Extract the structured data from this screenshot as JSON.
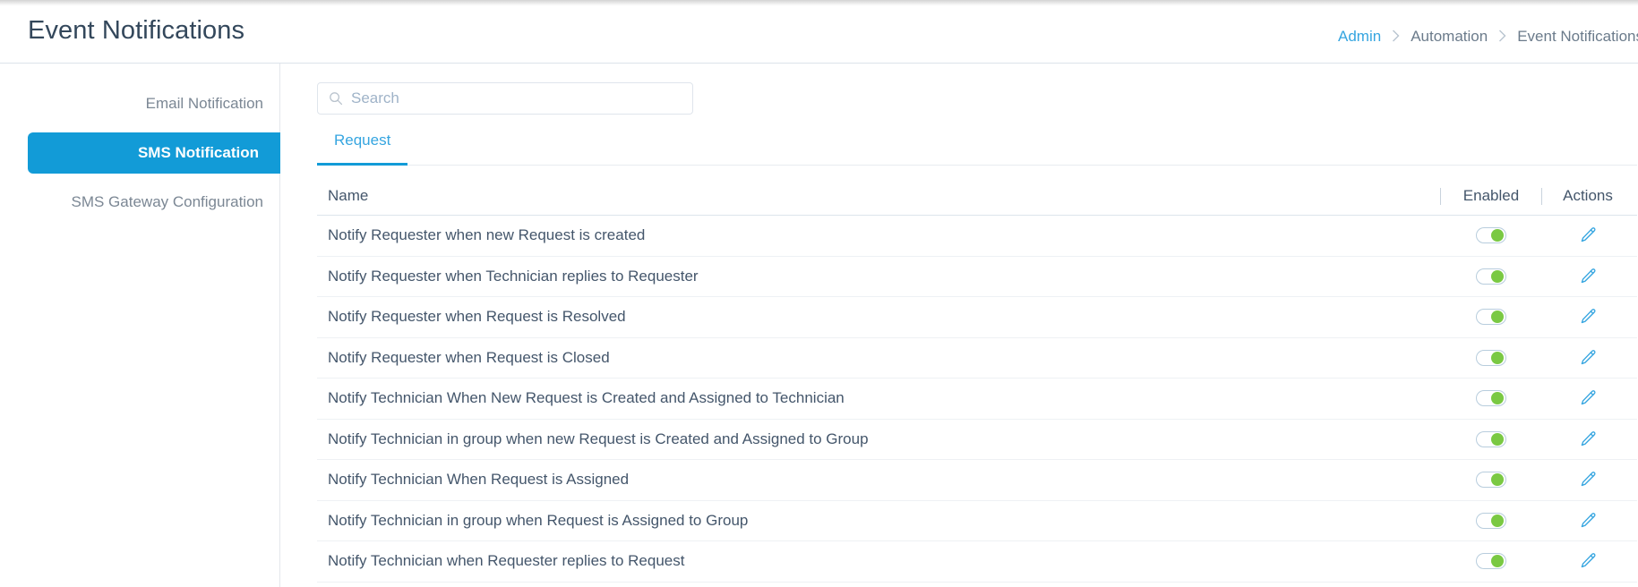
{
  "header": {
    "title": "Event Notifications",
    "breadcrumb": [
      {
        "label": "Admin",
        "link": true
      },
      {
        "label": "Automation",
        "link": false
      },
      {
        "label": "Event Notifications",
        "link": false
      }
    ],
    "separator_icon": "chevron-right-icon"
  },
  "sidebar": {
    "items": [
      {
        "label": "Email Notification",
        "active": false
      },
      {
        "label": "SMS Notification",
        "active": true
      },
      {
        "label": "SMS Gateway Configuration",
        "active": false
      }
    ]
  },
  "search": {
    "value": "",
    "placeholder": "Search",
    "icon": "search-icon"
  },
  "tabs": [
    {
      "label": "Request",
      "active": true
    }
  ],
  "table": {
    "columns": {
      "name": "Name",
      "enabled": "Enabled",
      "actions": "Actions"
    },
    "action_icon": "pencil-edit-icon",
    "rows": [
      {
        "name": "Notify Requester when new Request is created",
        "enabled": true
      },
      {
        "name": "Notify Requester when Technician replies to Requester",
        "enabled": true
      },
      {
        "name": "Notify Requester when Request is Resolved",
        "enabled": true
      },
      {
        "name": "Notify Requester when Request is Closed",
        "enabled": true
      },
      {
        "name": "Notify Technician When New Request is Created and Assigned to Technician",
        "enabled": true
      },
      {
        "name": "Notify Technician in group when new Request is Created and Assigned to Group",
        "enabled": true
      },
      {
        "name": "Notify Technician When Request is Assigned",
        "enabled": true
      },
      {
        "name": "Notify Technician in group when Request is Assigned to Group",
        "enabled": true
      },
      {
        "name": "Notify Technician when Requester replies to Request",
        "enabled": true
      }
    ]
  },
  "colors": {
    "accent_blue": "#129bd7",
    "link_blue": "#35a5e0",
    "title_navy": "#33475b",
    "text_gray": "#44566b",
    "muted_gray": "#7b8794",
    "toggle_on_green": "#7ac943",
    "border": "#dde3ea"
  }
}
